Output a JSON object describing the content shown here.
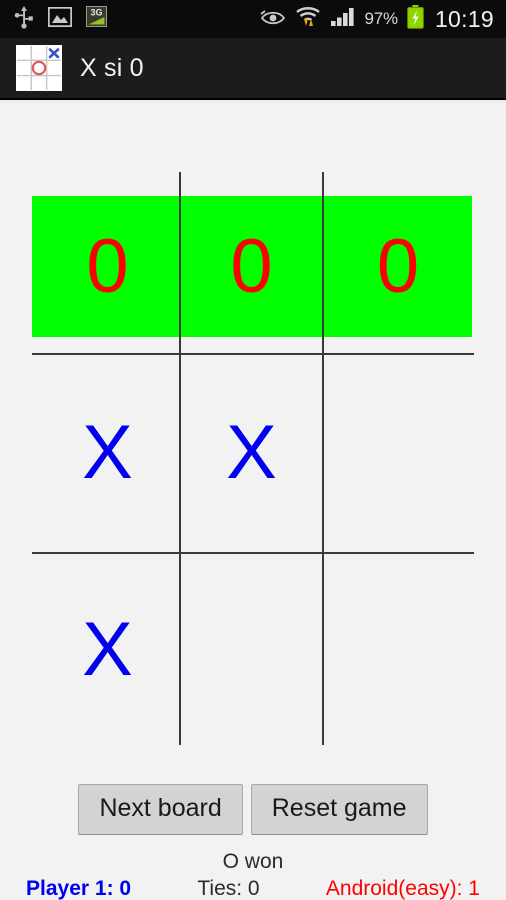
{
  "status_bar": {
    "left_icons": [
      "usb-icon",
      "gallery-image-icon",
      "3g-data-icon"
    ],
    "right_icons": [
      "smart-stay-eye-icon",
      "wifi-transfer-icon",
      "cellular-signal-icon",
      "battery-charging-icon"
    ],
    "battery_percent": "97%",
    "battery_label": "3G",
    "clock": "10:19"
  },
  "title_bar": {
    "app_icon": "tictactoe-icon",
    "title": "X si 0"
  },
  "board": {
    "cells": [
      {
        "id": "cell-0",
        "mark": "0",
        "player": "o",
        "highlight": true
      },
      {
        "id": "cell-1",
        "mark": "0",
        "player": "o",
        "highlight": true
      },
      {
        "id": "cell-2",
        "mark": "0",
        "player": "o",
        "highlight": true
      },
      {
        "id": "cell-3",
        "mark": "X",
        "player": "x",
        "highlight": false
      },
      {
        "id": "cell-4",
        "mark": "X",
        "player": "x",
        "highlight": false
      },
      {
        "id": "cell-5",
        "mark": "",
        "player": "",
        "highlight": false
      },
      {
        "id": "cell-6",
        "mark": "X",
        "player": "x",
        "highlight": false
      },
      {
        "id": "cell-7",
        "mark": "",
        "player": "",
        "highlight": false
      },
      {
        "id": "cell-8",
        "mark": "",
        "player": "",
        "highlight": false
      }
    ],
    "winning_line": "top-row",
    "highlight_color": "#00ff00",
    "x_color": "#0000ee",
    "o_color": "#ff0000",
    "grid_color": "#3a3a3a"
  },
  "controls": {
    "next_board_label": "Next board",
    "reset_game_label": "Reset game"
  },
  "result": {
    "status_text": "O won"
  },
  "scores": {
    "player1": "Player 1: 0",
    "ties": "Ties: 0",
    "android": "Android(easy): 1",
    "player1_color": "#0000ee",
    "android_color": "#ff0000"
  }
}
